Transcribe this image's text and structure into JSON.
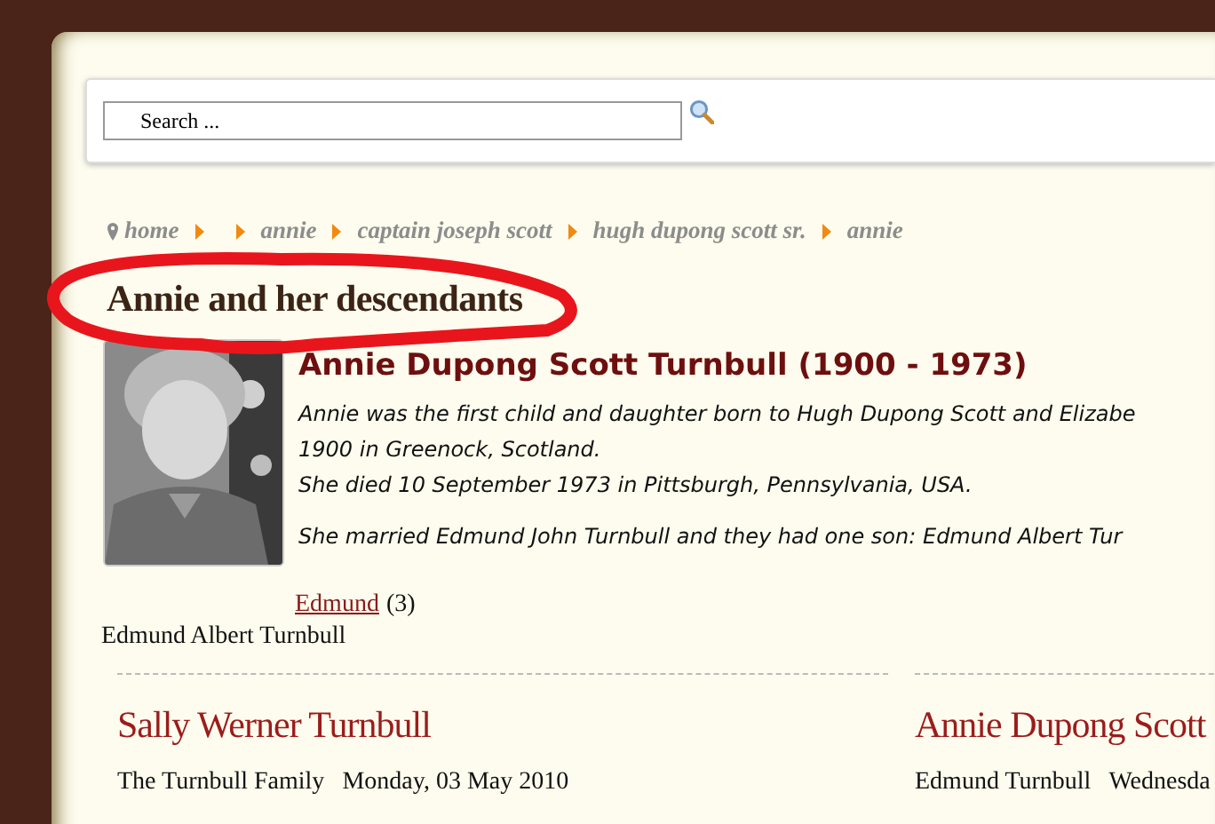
{
  "search": {
    "placeholder": "Search ..."
  },
  "breadcrumb": [
    {
      "kind": "home",
      "label": "home"
    },
    {
      "kind": "empty"
    },
    {
      "kind": "link",
      "label": "annie"
    },
    {
      "kind": "link",
      "label": "captain joseph scott"
    },
    {
      "kind": "link",
      "label": "hugh dupong scott sr."
    },
    {
      "kind": "link",
      "label": "annie"
    }
  ],
  "page_title": "Annie and her descendants",
  "person": {
    "name": "Annie Dupong Scott Turnbull (1900 - 1973)",
    "bio_lines": [
      "Annie was the first child and daughter born to Hugh Dupong Scott and Elizabe",
      "1900 in Greenock, Scotland.",
      "She died 10 September 1973 in Pittsburgh, Pennsylvania, USA."
    ],
    "marriage": "She married Edmund John Turnbull and they had one son: Edmund Albert Tur",
    "child_link": "Edmund",
    "child_count": "(3)",
    "caption": "Edmund Albert Turnbull"
  },
  "articles": [
    {
      "title": "Sally Werner Turnbull",
      "author": "The Turnbull Family",
      "date": "Monday, 03 May 2010"
    },
    {
      "title": "Annie Dupong Scott",
      "author": "Edmund Turnbull",
      "date": "Wednesda"
    }
  ]
}
